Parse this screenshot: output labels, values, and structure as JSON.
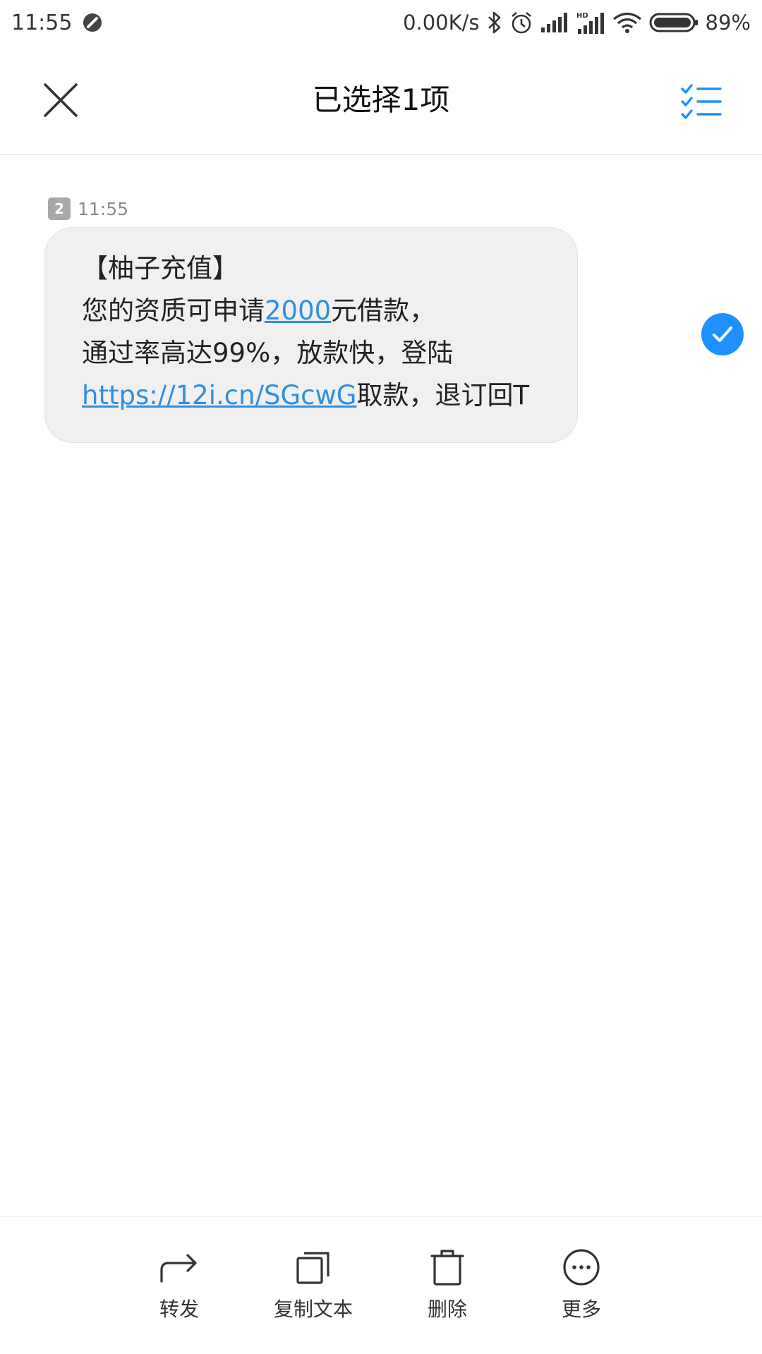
{
  "status_bar": {
    "time": "11:55",
    "net_speed": "0.00K/s",
    "battery_percent": "89%",
    "battery_level": 0.89,
    "icons": [
      "dnd-icon",
      "bluetooth-icon",
      "alarm-icon",
      "signal-icon",
      "hd-signal-icon",
      "wifi-icon",
      "battery-icon"
    ]
  },
  "header": {
    "title": "已选择1项",
    "accent_color": "#1e90ff"
  },
  "message": {
    "sim": "2",
    "time": "11:55",
    "lines": {
      "l1": "【柚子充值】",
      "l2_pre": "您的资质可申请",
      "l2_link": "2000",
      "l2_post": "元借款，",
      "l3": "通过率高达99%，放款快，登陆",
      "l4_link": "https://12i.cn/SGcwG",
      "l4_post": "取款，退订回T"
    },
    "selected": true
  },
  "actions": [
    {
      "label": "转发",
      "icon": "forward-icon"
    },
    {
      "label": "复制文本",
      "icon": "copy-icon"
    },
    {
      "label": "删除",
      "icon": "trash-icon"
    },
    {
      "label": "更多",
      "icon": "more-icon"
    }
  ]
}
